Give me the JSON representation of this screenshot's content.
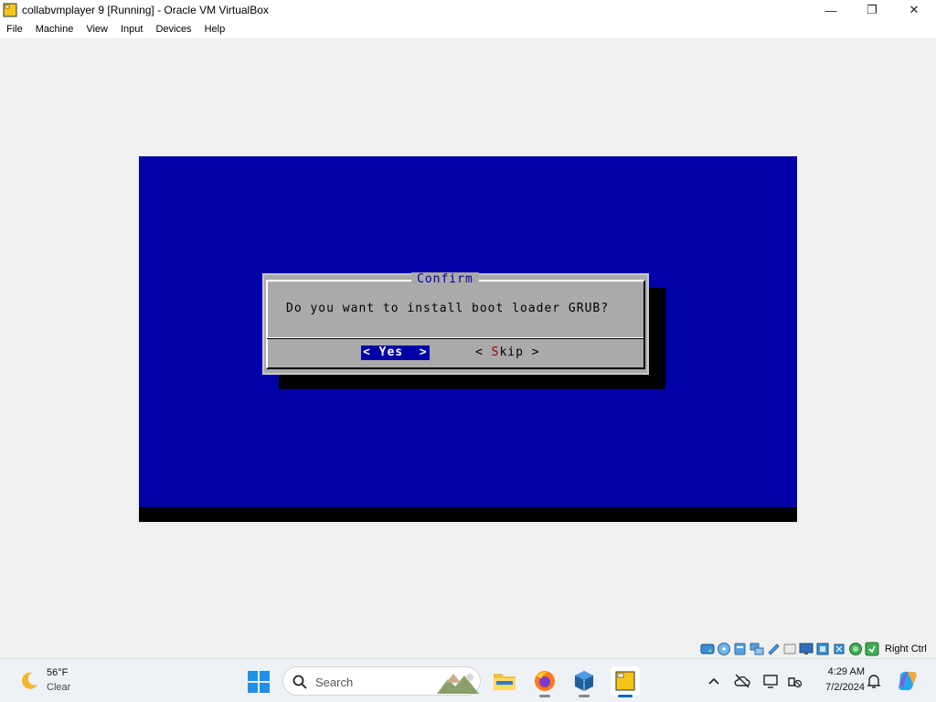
{
  "window": {
    "title": "collabvmplayer 9 [Running] - Oracle VM VirtualBox",
    "minimize_glyph": "—",
    "maximize_glyph": "❐",
    "close_glyph": "✕"
  },
  "menubar": {
    "items": [
      "File",
      "Machine",
      "View",
      "Input",
      "Devices",
      "Help"
    ]
  },
  "vm": {
    "background_color": "#0000a8",
    "dialog": {
      "title": "Confirm",
      "message": "Do you want to install boot loader GRUB?",
      "yes_button": "< Yes  >",
      "skip_prefix": "< ",
      "skip_hotkey": "S",
      "skip_rest": "kip >"
    }
  },
  "statusbar": {
    "icons": [
      "hard-disk-icon",
      "optical-drive-icon",
      "audio-icon",
      "network-icon",
      "usb-icon",
      "shared-folders-icon",
      "display-icon",
      "video-capture-icon",
      "cpu-icon",
      "guest-additions-icon",
      "keyboard-capture-icon"
    ],
    "host_key_label": "Right Ctrl"
  },
  "taskbar": {
    "weather": {
      "temperature": "56°F",
      "condition": "Clear",
      "icon": "moon-icon"
    },
    "search_placeholder": "Search",
    "apps": [
      "windows-start-icon",
      "file-explorer-icon",
      "firefox-icon",
      "virtualbox-icon",
      "collabvm-icon"
    ],
    "clock": {
      "time": "4:29 AM",
      "date": "7/2/2024"
    }
  }
}
